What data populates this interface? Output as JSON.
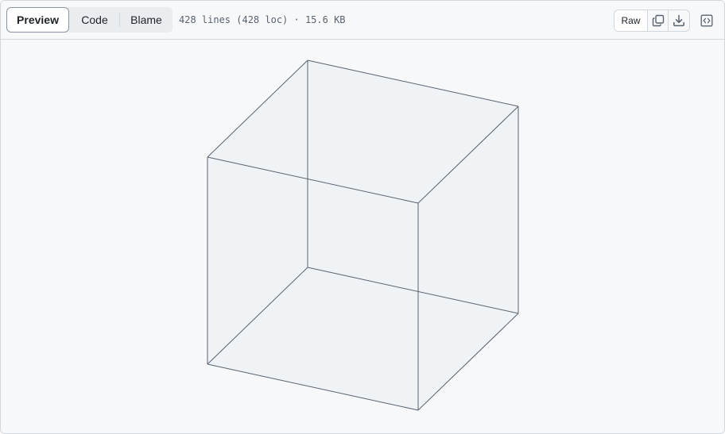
{
  "toolbar": {
    "tabs": [
      {
        "label": "Preview",
        "active": true
      },
      {
        "label": "Code",
        "active": false
      },
      {
        "label": "Blame",
        "active": false
      }
    ],
    "file_meta": "428 lines (428 loc) · 15.6 KB",
    "raw_label": "Raw",
    "icons": {
      "copy": "copy-icon",
      "download": "download-icon",
      "symbols": "code-square-icon"
    }
  },
  "preview": {
    "content": "wireframe-cube",
    "colors": {
      "edge": "#59636e",
      "face": "#eef1f4",
      "background": "#f6f8fa"
    }
  }
}
